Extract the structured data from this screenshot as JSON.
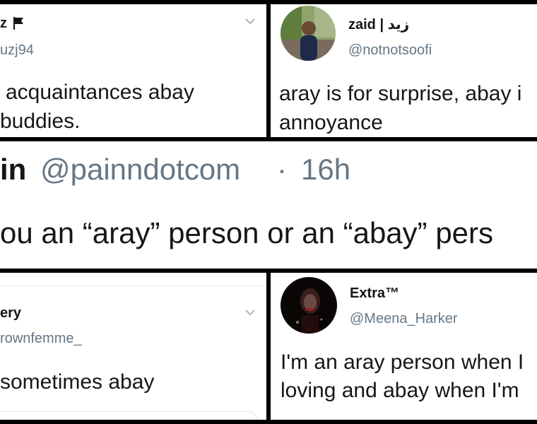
{
  "collage": {
    "top_left": {
      "name_fragment": "z",
      "flag_icon": "flag-icon",
      "handle_fragment": "uzj94",
      "lines": [
        "acquaintances abay",
        "buddies."
      ]
    },
    "top_right": {
      "name": "zaid | زيد",
      "handle": "@notnotsoofi",
      "lines": [
        "aray is for surprise, abay i",
        "annoyance"
      ]
    },
    "middle": {
      "name_fragment": "in",
      "handle": "@painndotcom",
      "separator": "·",
      "time": "16h",
      "text": "ou an “aray” person or an “abay” pers"
    },
    "bottom_left": {
      "name_fragment": "ery",
      "handle_fragment": "rownfemme_",
      "text": "sometimes abay"
    },
    "bottom_right": {
      "name": "Extra™",
      "handle": "@Meena_Harker",
      "lines": [
        "I'm an aray person when I",
        "loving and abay when I'm"
      ]
    }
  },
  "colors": {
    "text": "#14171a",
    "handle": "#657786",
    "chevron": "#aab8c2",
    "border": "#000000"
  }
}
